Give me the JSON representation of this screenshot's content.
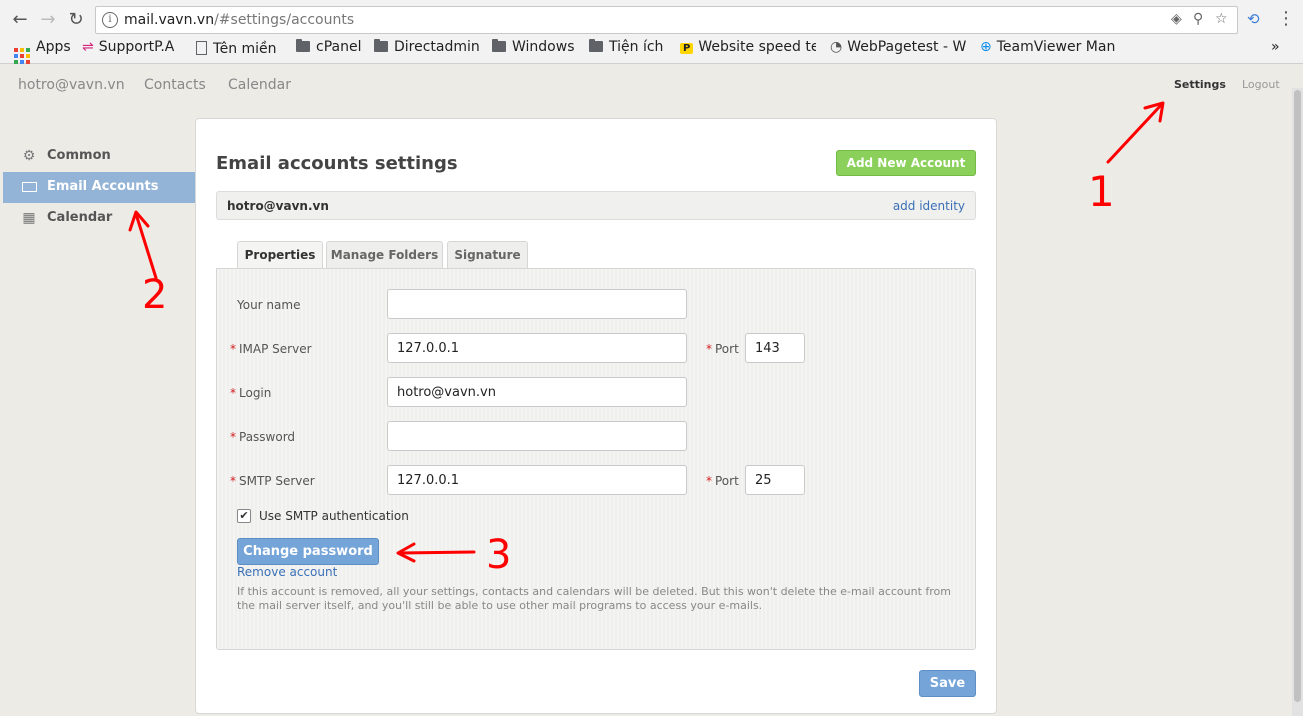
{
  "browser": {
    "url_host": "mail.vavn.vn",
    "url_rest": "/#settings/accounts",
    "bookmarks": [
      {
        "label": "Apps",
        "icon": "apps-grid-icon"
      },
      {
        "label": "SupportP.A",
        "icon": "support-icon"
      },
      {
        "label": "Tên miền",
        "icon": "page-icon"
      },
      {
        "label": "cPanel",
        "icon": "folder-icon"
      },
      {
        "label": "Directadmin",
        "icon": "folder-icon"
      },
      {
        "label": "Windows",
        "icon": "folder-icon"
      },
      {
        "label": "Tiện ích",
        "icon": "folder-icon"
      },
      {
        "label": "Website speed te",
        "icon": "pingdom-icon"
      },
      {
        "label": "WebPagetest - W",
        "icon": "speedometer-icon"
      },
      {
        "label": "TeamViewer Man",
        "icon": "teamviewer-icon"
      }
    ],
    "more": "»"
  },
  "header": {
    "user": "hotro@vavn.vn",
    "nav": [
      "Contacts",
      "Calendar"
    ],
    "settings": "Settings",
    "logout": "Logout"
  },
  "sidebar": {
    "items": [
      {
        "label": "Common",
        "icon": "gear-icon"
      },
      {
        "label": "Email Accounts",
        "icon": "envelope-icon"
      },
      {
        "label": "Calendar",
        "icon": "calendar-icon"
      }
    ]
  },
  "main": {
    "title": "Email accounts settings",
    "add_account": "Add New Account",
    "account_email": "hotro@vavn.vn",
    "add_identity": "add identity",
    "tabs": [
      "Properties",
      "Manage Folders",
      "Signature"
    ],
    "form": {
      "your_name_label": "Your name",
      "your_name_value": "",
      "imap_label": "IMAP Server",
      "imap_value": "127.0.0.1",
      "imap_port_label": "Port",
      "imap_port_value": "143",
      "login_label": "Login",
      "login_value": "hotro@vavn.vn",
      "password_label": "Password",
      "password_value": "",
      "smtp_label": "SMTP Server",
      "smtp_value": "127.0.0.1",
      "smtp_port_label": "Port",
      "smtp_port_value": "25",
      "smtp_auth_label": "Use SMTP authentication",
      "required_mark": "*"
    },
    "change_password": "Change password",
    "remove_account": "Remove account",
    "notice": "If this account is removed, all your settings, contacts and calendars will be deleted. But this won't delete the e-mail account from the mail server itself, and you'll still be able to use other mail programs to access your e-mails.",
    "save": "Save"
  },
  "annotations": {
    "one": "1",
    "two": "2",
    "three": "3",
    "color": "#ff0000"
  }
}
